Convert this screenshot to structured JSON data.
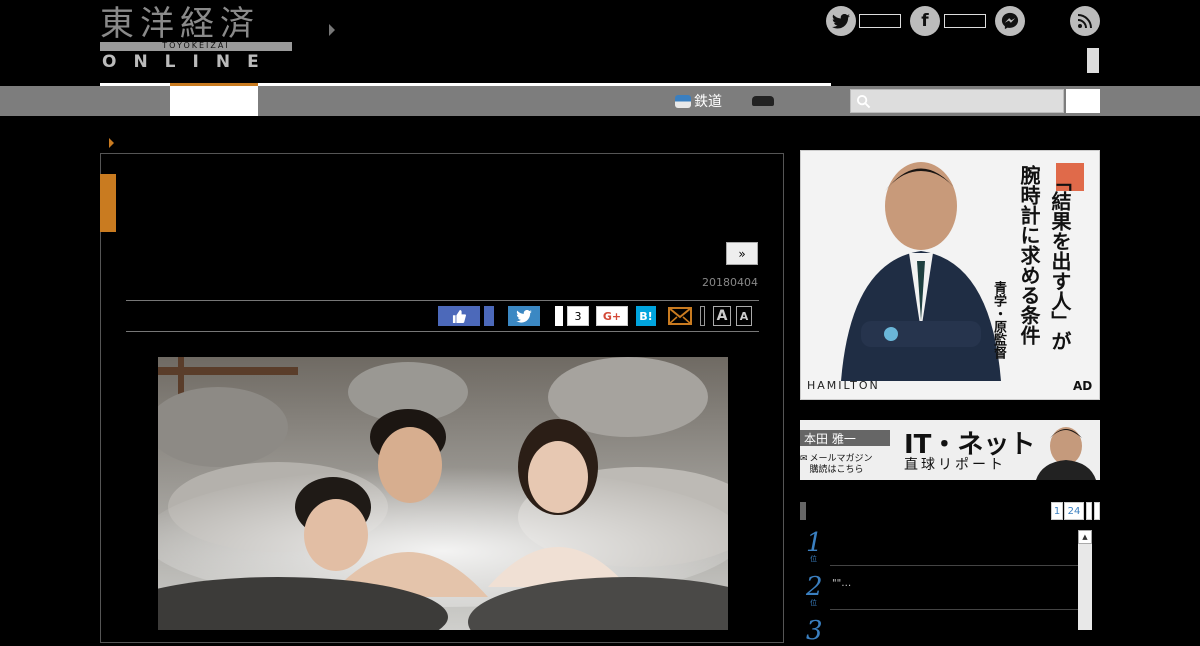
{
  "header": {
    "logo_kanji": "東洋経済",
    "logo_sub": "TOYOKEIZAI",
    "logo_online": "ONLINE",
    "social": {
      "twitter_icon": "twitter-bird",
      "facebook_glyph": "f",
      "messenger_icon": "messenger",
      "rss_icon": "rss"
    }
  },
  "nav": {
    "items": [
      {
        "label": "鉄道",
        "icon": "train-icon"
      },
      {
        "label": "",
        "icon": "car-icon"
      }
    ],
    "search": {
      "placeholder": ""
    }
  },
  "article": {
    "next_label": "»",
    "date": "20180404",
    "share": {
      "twitter_glyph": "🐦",
      "count": "3",
      "gplus_label": "G+",
      "hatena_label": "B!",
      "font_large": "A",
      "font_small": "A"
    }
  },
  "sidebar": {
    "ad1": {
      "headline_a": "「結果を出す人」が",
      "headline_b": "腕時計に求める条件",
      "byline": "青学・原監督",
      "brand": "HAMILTON",
      "ad_label": "AD"
    },
    "ad2": {
      "name": "本田 雅一",
      "mail_line1": "メールマガジン",
      "mail_line2": "購読はこちら",
      "title": "IT・ネット",
      "subtitle": "直球リポート"
    },
    "ranking": {
      "tabs": [
        "1",
        "24"
      ],
      "items": [
        {
          "rank": "1",
          "unit": "位",
          "text": ""
        },
        {
          "rank": "2",
          "unit": "位",
          "text": "\"\"…"
        },
        {
          "rank": "3",
          "unit": "位",
          "text": ""
        }
      ]
    }
  },
  "colors": {
    "accent_orange": "#c97b20",
    "nav_gray": "#7d7d7d",
    "facebook_blue": "#4c69ba",
    "twitter_blue": "#3b88c3",
    "hatena_blue": "#00a4de",
    "rank_blue": "#3a7fc0"
  }
}
